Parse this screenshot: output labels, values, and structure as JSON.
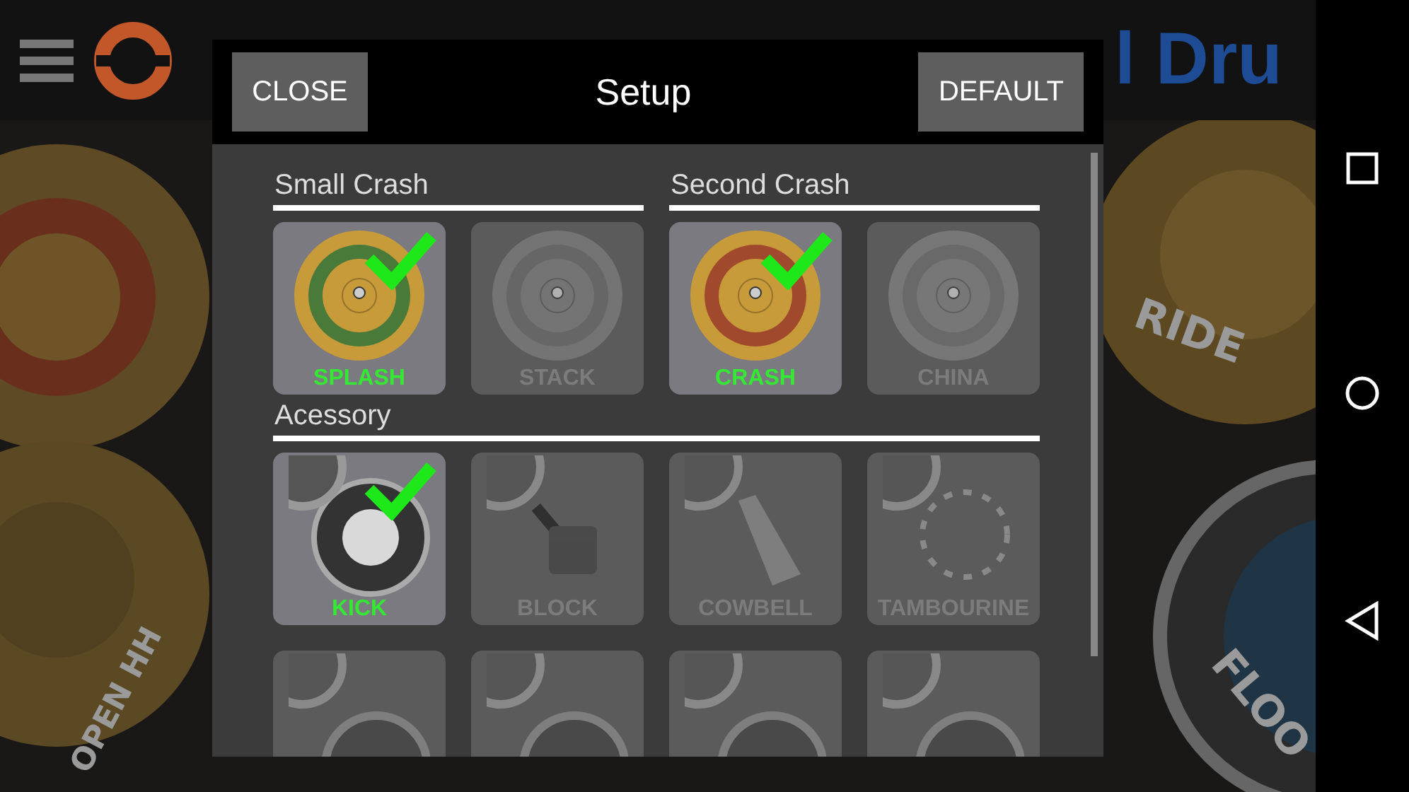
{
  "top_bar": {
    "logo": "l Dru"
  },
  "background": {
    "labels": [
      {
        "text": "RIDE",
        "kind": "ride"
      },
      {
        "text": "FLOO",
        "kind": "floor"
      },
      {
        "text": "OPEN HH",
        "kind": "hihat"
      }
    ]
  },
  "dialog": {
    "close_button": "CLOSE",
    "title": "Setup",
    "default_button": "DEFAULT",
    "sections": [
      {
        "title": "Small Crash",
        "items": [
          {
            "label": "SPLASH",
            "kind": "splash",
            "selected": true
          },
          {
            "label": "STACK",
            "kind": "stack",
            "selected": false
          }
        ]
      },
      {
        "title": "Second Crash",
        "items": [
          {
            "label": "CRASH",
            "kind": "crash",
            "selected": true
          },
          {
            "label": "CHINA",
            "kind": "china",
            "selected": false
          }
        ]
      },
      {
        "title": "Acessory",
        "items": [
          {
            "label": "KICK",
            "kind": "kick",
            "selected": true
          },
          {
            "label": "BLOCK",
            "kind": "block",
            "selected": false
          },
          {
            "label": "COWBELL",
            "kind": "cowbell",
            "selected": false
          },
          {
            "label": "TAMBOURINE",
            "kind": "tambourine",
            "selected": false
          },
          {
            "kind": "drum",
            "selected": false
          },
          {
            "kind": "drum",
            "selected": false
          },
          {
            "kind": "drum",
            "selected": false
          },
          {
            "kind": "drum",
            "selected": false
          }
        ]
      }
    ]
  }
}
